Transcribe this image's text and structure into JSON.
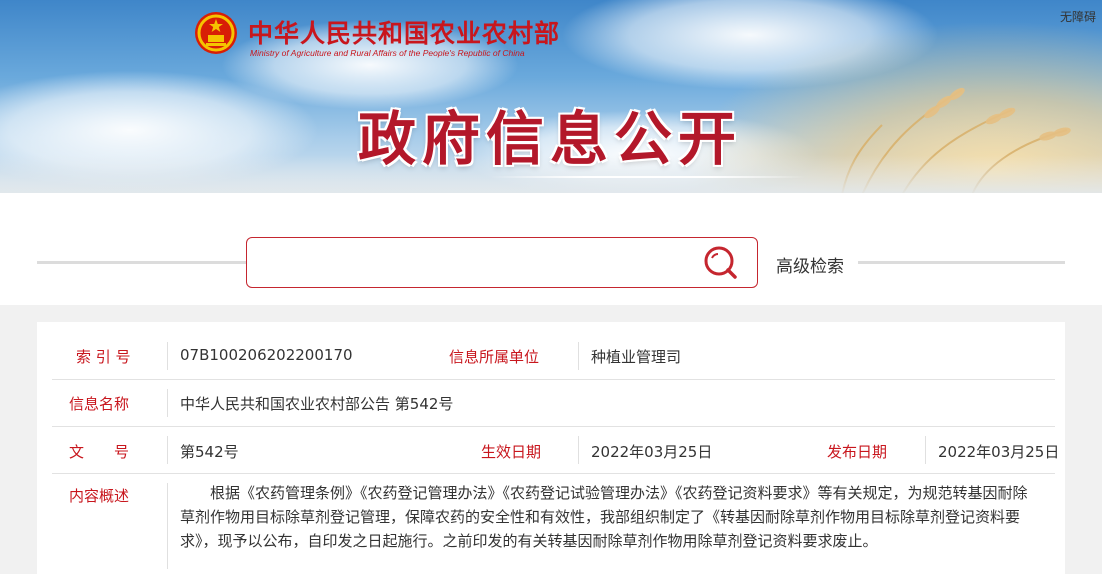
{
  "header": {
    "ministry_cn": "中华人民共和国农业农村部",
    "ministry_en": "Ministry of Agriculture and Rural Affairs of the People's Republic of China",
    "accessibility": "无障碍",
    "page_title": "政府信息公开",
    "emblem_icon": "national-emblem-icon",
    "brand_color": "#c8161d"
  },
  "search": {
    "placeholder": "",
    "value": "",
    "search_icon": "magnifier-icon",
    "advanced_label": "高级检索"
  },
  "info": {
    "index_label": "索 引 号",
    "index_value": "07B100206202200170",
    "unit_label": "信息所属单位",
    "unit_value": "种植业管理司",
    "name_label": "信息名称",
    "name_value": "中华人民共和国农业农村部公告 第542号",
    "doc_label": "文　　号",
    "doc_value": "第542号",
    "effective_label": "生效日期",
    "effective_value": "2022年03月25日",
    "publish_label": "发布日期",
    "publish_value": "2022年03月25日",
    "summary_label": "内容概述",
    "summary_value": "根据《农药管理条例》《农药登记管理办法》《农药登记试验管理办法》《农药登记资料要求》等有关规定，为规范转基因耐除草剂作物用目标除草剂登记管理，保障农药的安全性和有效性，我部组织制定了《转基因耐除草剂作物用目标除草剂登记资料要求》，现予以公布，自印发之日起施行。之前印发的有关转基因耐除草剂作物用除草剂登记资料要求废止。"
  }
}
